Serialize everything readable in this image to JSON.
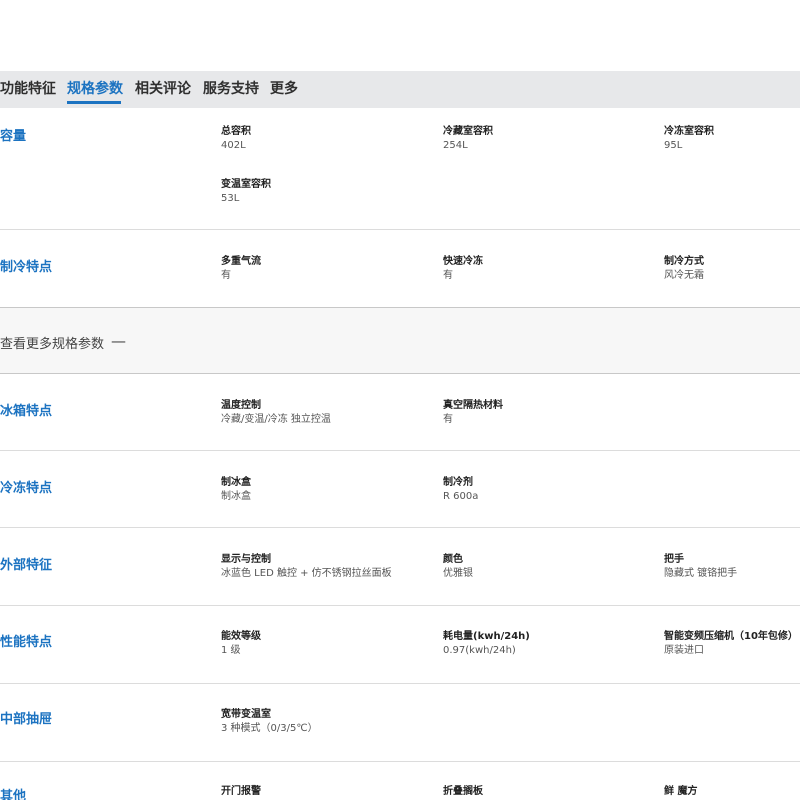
{
  "tabs": [
    {
      "label": "功能特征",
      "active": false
    },
    {
      "label": "规格参数",
      "active": true
    },
    {
      "label": "相关评论",
      "active": false
    },
    {
      "label": "服务支持",
      "active": false
    },
    {
      "label": "更多",
      "active": false
    }
  ],
  "colors": {
    "accent": "#1c73c1",
    "tabbar_bg": "#e7e8ea",
    "divider": "#dcdcdc"
  },
  "sections": [
    {
      "title": "容量",
      "specs": [
        {
          "name": "总容积",
          "value": "402L"
        },
        {
          "name": "冷藏室容积",
          "value": "254L"
        },
        {
          "name": "冷冻室容积",
          "value": "95L"
        },
        {
          "name": "变温室容积",
          "value": "53L"
        }
      ]
    },
    {
      "title": "制冷特点",
      "specs": [
        {
          "name": "多重气流",
          "value": "有"
        },
        {
          "name": "快速冷冻",
          "value": "有"
        },
        {
          "name": "制冷方式",
          "value": "风冷无霜"
        }
      ]
    }
  ],
  "more_toggle": {
    "label": "查看更多规格参数",
    "icon": "minus-icon",
    "symbol": "—"
  },
  "more_sections": [
    {
      "title": "冰箱特点",
      "specs": [
        {
          "name": "温度控制",
          "value": "冷藏/变温/冷冻 独立控温"
        },
        {
          "name": "真空隔热材料",
          "value": "有"
        }
      ]
    },
    {
      "title": "冷冻特点",
      "specs": [
        {
          "name": "制冰盒",
          "value": "制冰盒"
        },
        {
          "name": "制冷剂",
          "value": "R 600a"
        }
      ]
    },
    {
      "title": "外部特征",
      "specs": [
        {
          "name": "显示与控制",
          "value": "冰蓝色 LED 触控 + 仿不锈钢拉丝面板"
        },
        {
          "name": "颜色",
          "value": "优雅银"
        },
        {
          "name": "把手",
          "value": "隐藏式 镀铬把手"
        }
      ]
    },
    {
      "title": "性能特点",
      "specs": [
        {
          "name": "能效等级",
          "value": "1 级"
        },
        {
          "name": "耗电量(kwh/24h)",
          "value": "0.97(kwh/24h)"
        },
        {
          "name": "智能变频压缩机（10年包修）",
          "value": "原装进口"
        }
      ]
    },
    {
      "title": "中部抽屉",
      "specs": [
        {
          "name": "宽带变温室",
          "value": "3 种模式（0/3/5℃）"
        }
      ]
    },
    {
      "title": "其他",
      "specs": [
        {
          "name": "开门报警",
          "value": ""
        },
        {
          "name": "折叠搁板",
          "value": ""
        },
        {
          "name": "鲜 魔方",
          "value": ""
        }
      ]
    }
  ]
}
